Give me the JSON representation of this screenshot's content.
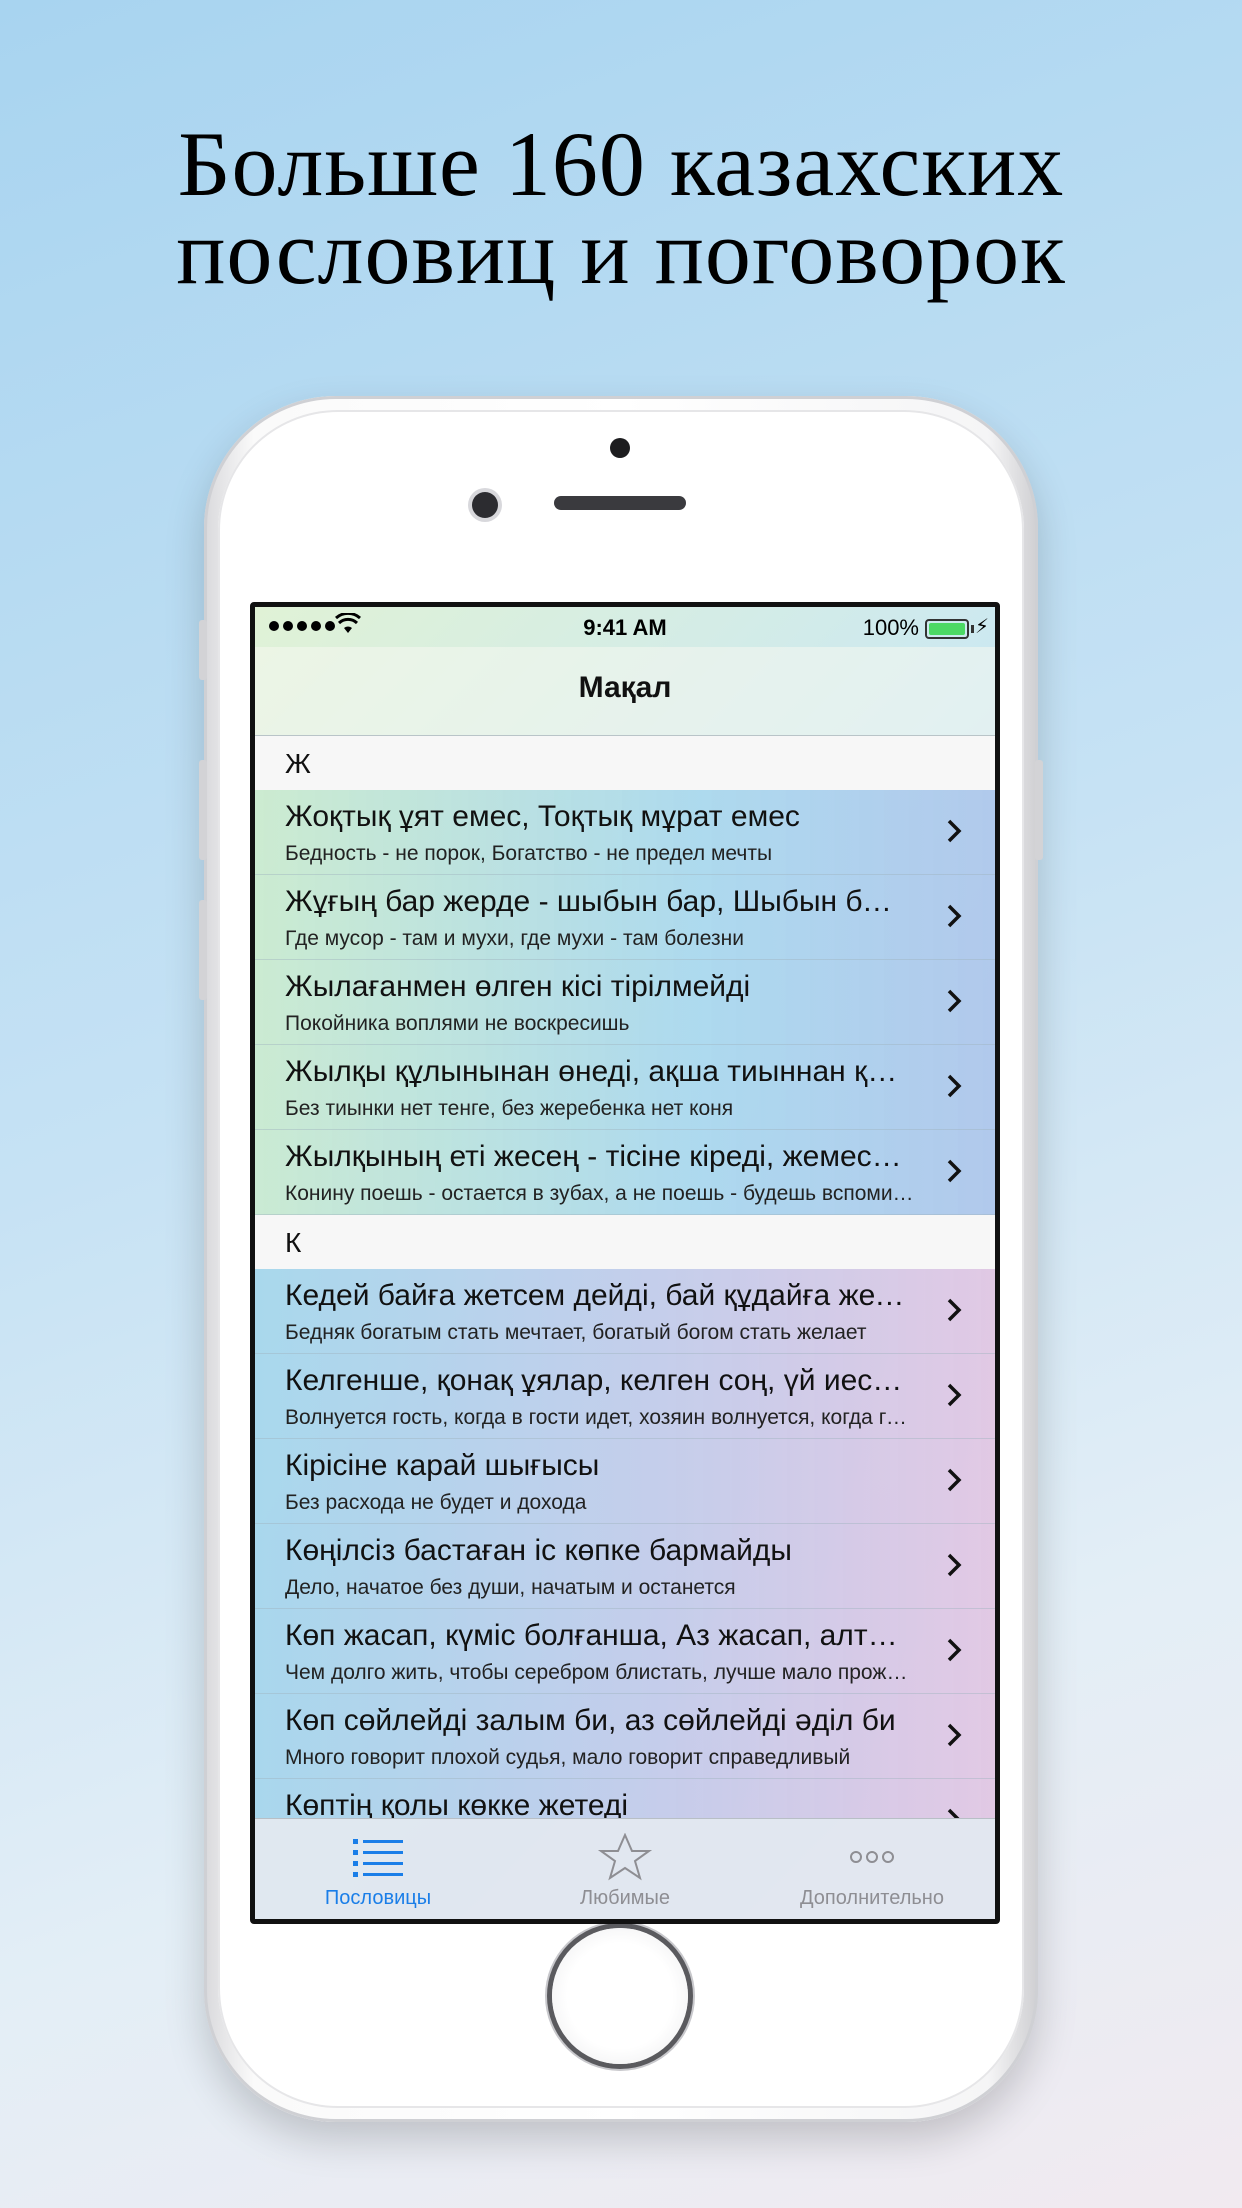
{
  "headline": {
    "line1": "Больше 160 казахских",
    "line2": "пословиц и поговорок"
  },
  "status_bar": {
    "time": "9:41 AM",
    "battery_percent": "100%"
  },
  "nav": {
    "title": "Мақал"
  },
  "sections": [
    {
      "header": "Ж",
      "rows": [
        {
          "title": "Жоқтық ұят емес, Тоқтық мұрат емес",
          "subtitle": "Бедность - не порок, Богатство - не предел мечты"
        },
        {
          "title": "Жұғың бар жерде - шыбын бар, Шыбын бар жерде - ауру бар",
          "subtitle": "Где мусор - там и мухи, где мухи - там болезни"
        },
        {
          "title": "Жылағанмен өлген кісі тірілмейді",
          "subtitle": "Покойника воплями не воскресишь"
        },
        {
          "title": "Жылқы құлынынан өнеді, ақша тиыннан құралады",
          "subtitle": "Без тиынки нет тенге, без жеребенка нет коня"
        },
        {
          "title": "Жылқының еті жесең - тісіне кіреді, жемесең - есіңе кіреді",
          "subtitle": "Конину поешь - остается в зубах, а не поешь - будешь вспоминать"
        }
      ]
    },
    {
      "header": "К",
      "rows": [
        {
          "title": "Кедей байға жетсем дейді, бай құдайға жетсем дейді",
          "subtitle": "Бедняк богатым стать мечтает, богатый богом стать желает"
        },
        {
          "title": "Келгенше, қонақ ұялар, келген соң, үй иесі ұялар",
          "subtitle": "Волнуется гость, когда в гости идет, хозяин волнуется, когда гость придет"
        },
        {
          "title": "Кірісіне карай шығысы",
          "subtitle": "Без расхода не будет и дохода"
        },
        {
          "title": "Көңілсіз бастаған іс көпке бармайды",
          "subtitle": "Дело, начатое без души, начатым и останется"
        },
        {
          "title": "Көп жасап, күміс болғанша, Аз жасап, алтын бол",
          "subtitle": "Чем долго жить, чтобы серебром блистать, лучше мало прожить, но золотом стать"
        },
        {
          "title": "Көп сөйлейді залым би, аз сөйлейді әділ би",
          "subtitle": "Много говорит плохой судья, мало говорит справедливый"
        },
        {
          "title": "Көптің қолы көкке жетеді",
          "subtitle": ""
        }
      ]
    }
  ],
  "tab_bar": {
    "tabs": [
      {
        "label": "Пословицы",
        "icon": "list-icon",
        "active": true
      },
      {
        "label": "Любимые",
        "icon": "star-icon",
        "active": false
      },
      {
        "label": "Дополнительно",
        "icon": "more-icon",
        "active": false
      }
    ]
  },
  "colors": {
    "accent": "#1a7ee8",
    "inactive": "#8e8e93",
    "battery": "#4cd964"
  }
}
